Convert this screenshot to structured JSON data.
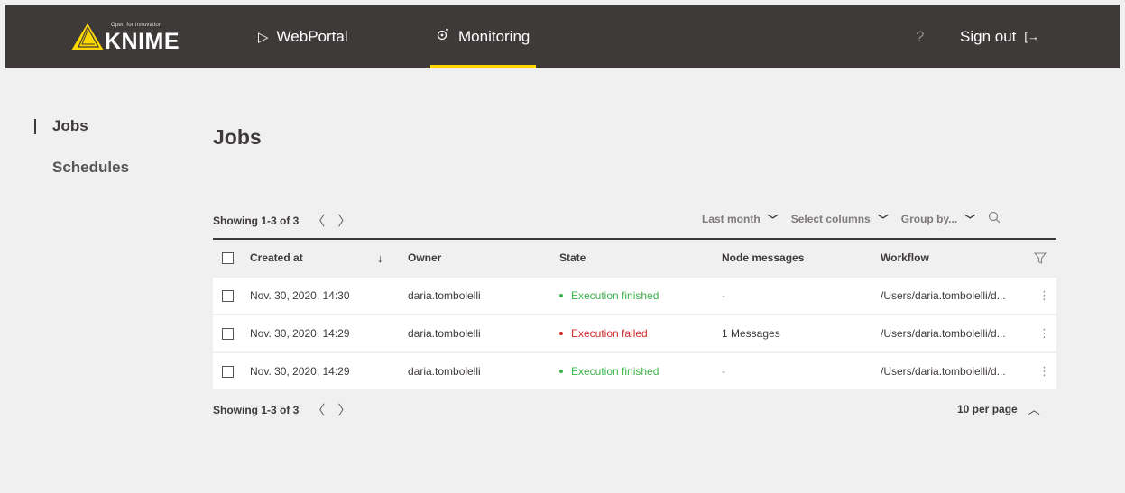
{
  "header": {
    "logo_tagline": "Open for Innovation",
    "logo_word": "KNIME",
    "nav": [
      {
        "label": "WebPortal",
        "icon": "play-icon"
      },
      {
        "label": "Monitoring",
        "icon": "monitoring-icon",
        "active": true
      }
    ],
    "help": "?",
    "signout": "Sign out"
  },
  "sidebar": {
    "items": [
      {
        "label": "Jobs",
        "active": true
      },
      {
        "label": "Schedules"
      }
    ]
  },
  "main": {
    "title": "Jobs",
    "pager_text": "Showing 1-3 of 3",
    "filters": {
      "period": "Last month",
      "columns": "Select columns",
      "group": "Group by..."
    },
    "columns": [
      "Created at",
      "Owner",
      "State",
      "Node messages",
      "Workflow"
    ],
    "rows": [
      {
        "created": "Nov. 30, 2020, 14:30",
        "owner": "daria.tombolelli",
        "state": "Execution finished",
        "status": "ok",
        "messages": "-",
        "workflow": "/Users/daria.tombolelli/d..."
      },
      {
        "created": "Nov. 30, 2020, 14:29",
        "owner": "daria.tombolelli",
        "state": "Execution failed",
        "status": "fail",
        "messages": "1 Messages",
        "workflow": "/Users/daria.tombolelli/d..."
      },
      {
        "created": "Nov. 30, 2020, 14:29",
        "owner": "daria.tombolelli",
        "state": "Execution finished",
        "status": "ok",
        "messages": "-",
        "workflow": "/Users/daria.tombolelli/d..."
      }
    ],
    "per_page": "10 per page"
  },
  "colors": {
    "header_bg": "#3e3a39",
    "accent": "#ffd800",
    "success": "#3cb44b",
    "error": "#d12b2b"
  }
}
